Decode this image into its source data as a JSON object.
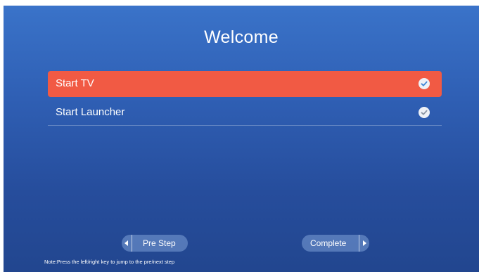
{
  "page": {
    "title": "Welcome"
  },
  "options": [
    {
      "label": "Start TV",
      "selected": true,
      "icon": "check-icon"
    },
    {
      "label": "Start Launcher",
      "selected": false,
      "icon": "check-icon"
    }
  ],
  "buttons": {
    "pre_step": {
      "label": "Pre Step",
      "icon": "left-arrow-icon"
    },
    "complete": {
      "label": "Complete",
      "icon": "right-arrow-icon"
    }
  },
  "footer": {
    "note": "Note:Press the left/right key to jump to the pre/next step"
  },
  "colors": {
    "background_top": "#3a73c9",
    "background_bottom": "#22468f",
    "selected_row": "#f15a44",
    "check_selected": "#3f86d6",
    "check_unselected": "#8a94a3"
  }
}
